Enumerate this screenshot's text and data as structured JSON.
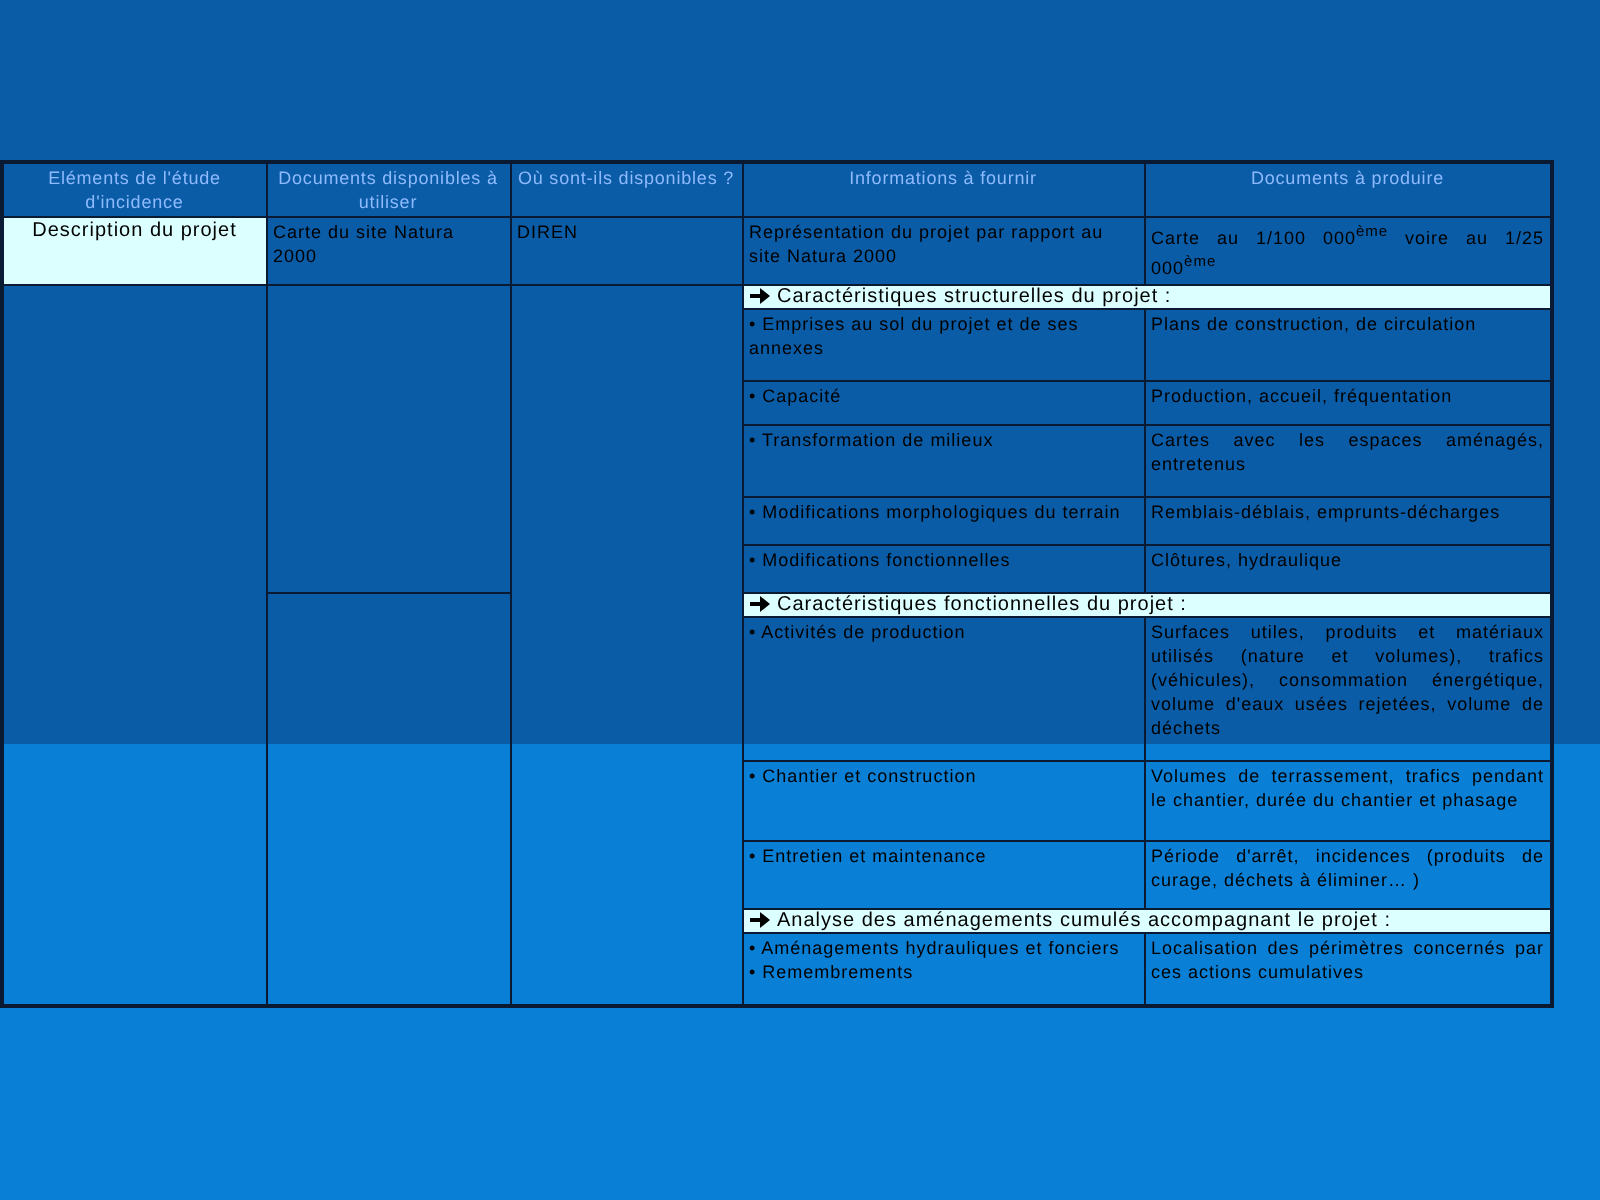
{
  "table": {
    "columns": [
      "Eléments de l'étude d'incidence",
      "Documents disponibles à utiliser",
      "Où sont-ils disponibles ?",
      "Informations à fournir",
      "Documents à produire"
    ],
    "first_row": {
      "element": "Description du projet",
      "documents": "Carte du site Natura 2000",
      "source": "DIREN",
      "information": "Représentation du projet par rapport au site Natura 2000",
      "output": "Carte au 1/100 000$^{ème}$ voire au 1/25 000$^{ème}$"
    },
    "sections": [
      {
        "title": "Caractéristiques structurelles du projet :",
        "items": [
          {
            "information": [
              "• Emprises au sol du projet et de ses annexes"
            ],
            "output": "Plans de construction, de circulation"
          },
          {
            "information": [
              "• Capacité"
            ],
            "output": "Production, accueil, fréquentation"
          },
          {
            "information": [
              "• Transformation de milieux"
            ],
            "output": "Cartes avec les espaces aménagés, entretenus"
          },
          {
            "information": [
              "• Modifications morphologiques du terrain"
            ],
            "output": "Remblais-déblais, emprunts-décharges"
          },
          {
            "information": [
              "• Modifications fonctionnelles"
            ],
            "output": "Clôtures, hydraulique"
          }
        ]
      },
      {
        "title": "Caractéristiques fonctionnelles du projet :",
        "items": [
          {
            "information": [
              "• Activités de production"
            ],
            "output": "Surfaces utiles, produits et matériaux utilisés (nature et volumes), trafics (véhicules), consommation énergétique, volume d'eaux usées rejetées, volume de déchets"
          },
          {
            "information": [
              "• Chantier et construction"
            ],
            "output": "Volumes de terrassement, trafics pendant le chantier, durée du chantier et phasage"
          },
          {
            "information": [
              "• Entretien et maintenance"
            ],
            "output": "Période d'arrêt, incidences (produits de curage, déchets à éliminer… )"
          }
        ]
      },
      {
        "title": "Analyse des aménagements cumulés accompagnant le projet :",
        "items": [
          {
            "information": [
              "• Aménagements hydrauliques et fonciers",
              "• Remembrements"
            ],
            "output": "Localisation des périmètres concernés par ces actions cumulatives"
          }
        ]
      }
    ]
  }
}
